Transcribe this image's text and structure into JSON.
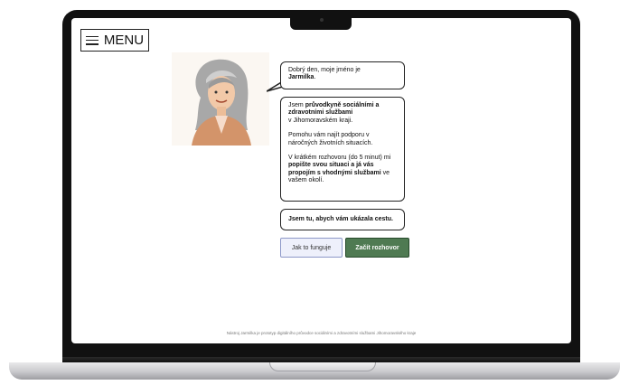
{
  "header": {
    "menu_label": "MENU"
  },
  "chat": {
    "greeting_prefix": "Dobrý den, moje jméno je",
    "greeting_name": "Jarmilka",
    "greeting_suffix": ".",
    "intro_1": "Jsem",
    "intro_bold": "průvodkyně sociálními a zdravotními službami",
    "intro_2": "v Jihomoravském kraji.",
    "help": "Pomohu vám najít podporu v náročných životních situacích.",
    "instr_1": "V krátkém rozhovoru (do 5 minut) mi",
    "instr_bold": "popište svou situaci a já vás propojím s vhodnými službami",
    "instr_2": "ve vašem okolí.",
    "tagline": "Jsem tu, abych vám ukázala cestu."
  },
  "buttons": {
    "how_it_works": "Jak to funguje",
    "start": "Začít rozhovor"
  },
  "footer": {
    "text": "Nástroj Jarmilka je prototyp digitálního průvodce sociálními a zdravotními službami Jihomoravského kraje"
  },
  "colors": {
    "primary": "#4f7a52",
    "secondary_bg": "#eef0fb",
    "secondary_border": "#8d98c8"
  }
}
